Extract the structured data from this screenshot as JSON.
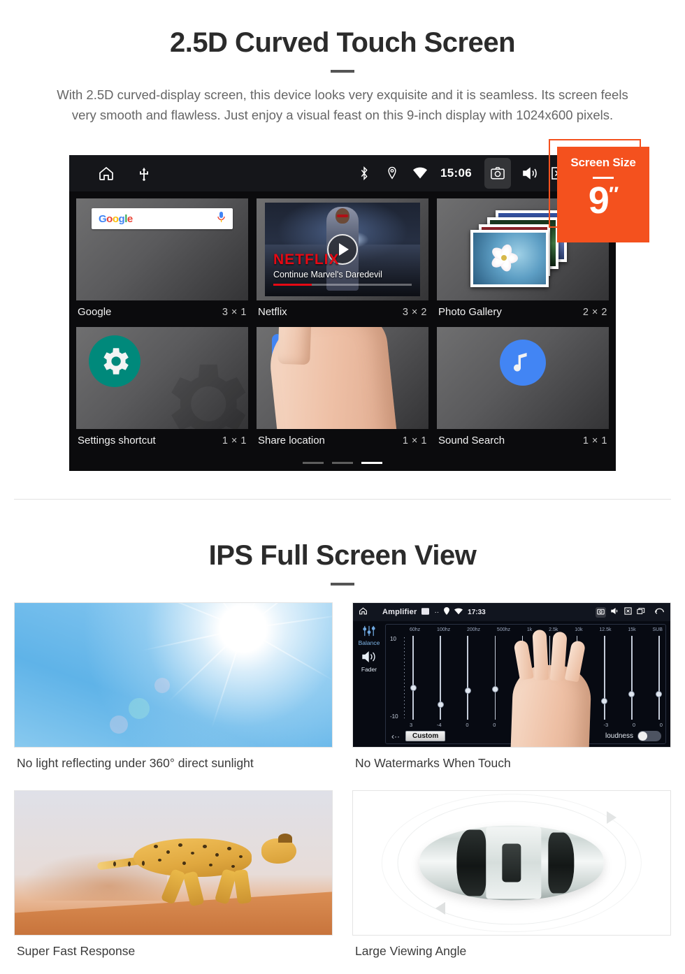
{
  "section1": {
    "title": "2.5D Curved Touch Screen",
    "description": "With 2.5D curved-display screen, this device looks very exquisite and it is seamless. Its screen feels very smooth and flawless. Just enjoy a visual feast on this 9-inch display with 1024x600 pixels."
  },
  "badge": {
    "label": "Screen Size",
    "value": "9",
    "unit": "″",
    "color": "#f4511e"
  },
  "device": {
    "statusbar": {
      "left_icons": [
        "home-icon",
        "usb-icon"
      ],
      "right_icons": [
        "bluetooth-icon",
        "location-icon",
        "wifi-icon"
      ],
      "clock": "15:06",
      "trailing_icons": [
        "camera-icon",
        "volume-icon",
        "close-box-icon",
        "recents-icon"
      ]
    },
    "widgets": [
      {
        "name": "Google",
        "size": "3 × 1",
        "icon": "google-search-widget",
        "search_placeholder": "",
        "logo_letters": [
          "G",
          "o",
          "o",
          "g",
          "l",
          "e"
        ]
      },
      {
        "name": "Netflix",
        "size": "3 × 2",
        "icon": "netflix-widget",
        "brand": "NETFLIX",
        "subtitle": "Continue Marvel's Daredevil"
      },
      {
        "name": "Photo Gallery",
        "size": "2 × 2",
        "icon": "photo-gallery-widget"
      },
      {
        "name": "Settings shortcut",
        "size": "1 × 1",
        "icon": "gear-icon"
      },
      {
        "name": "Share location",
        "size": "1 × 1",
        "icon": "google-maps-icon"
      },
      {
        "name": "Sound Search",
        "size": "1 × 1",
        "icon": "music-note-icon"
      }
    ],
    "page_indicator": {
      "count": 3,
      "active": 3
    }
  },
  "section2": {
    "title": "IPS Full Screen View",
    "items": [
      {
        "caption": "No light reflecting under 360° direct sunlight",
        "image": "sunlight-sky-photo"
      },
      {
        "caption": "No Watermarks When Touch",
        "image": "amplifier-equalizer-screen"
      },
      {
        "caption": "Super Fast Response",
        "image": "running-cheetah-photo"
      },
      {
        "caption": "Large Viewing Angle",
        "image": "car-top-view-illustration"
      }
    ]
  },
  "amplifier": {
    "title": "Amplifier",
    "clock": "17:33",
    "side_labels": [
      "Balance",
      "Fader"
    ],
    "bands": [
      "60hz",
      "100hz",
      "200hz",
      "500hz",
      "1k",
      "2.5k",
      "10k",
      "12.5k",
      "15k",
      "SUB"
    ],
    "scale_top": "10",
    "scale_bottom": "-10",
    "values": [
      "3",
      "-4",
      "0",
      "0",
      "0",
      "-3",
      "0",
      "-3",
      "0",
      "0"
    ],
    "preset_button": "Custom",
    "loudness_label": "loudness",
    "loudness_on": false
  }
}
